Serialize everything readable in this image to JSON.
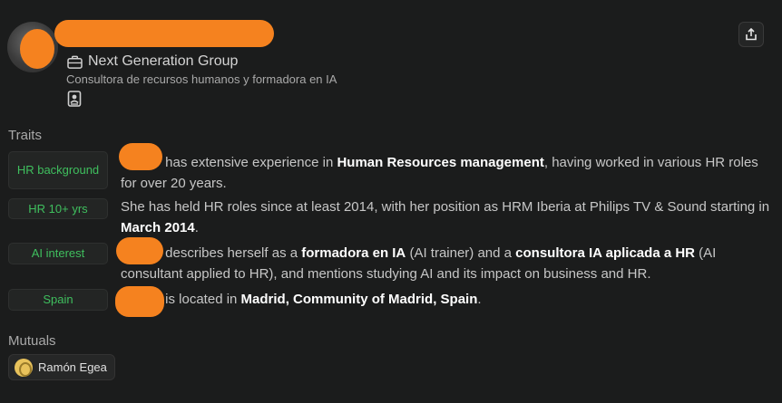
{
  "profile": {
    "company": "Next Generation Group",
    "tagline": "Consultora de recursos humanos y formadora en IA"
  },
  "sections": {
    "traits_title": "Traits",
    "mutuals_title": "Mutuals"
  },
  "traits": [
    {
      "label": "HR background",
      "parts": [
        {
          "t": " has extensive experience in ",
          "b": false
        },
        {
          "t": "Human Resources management",
          "b": true
        },
        {
          "t": ", having worked in various HR roles for over 20 years.",
          "b": false
        }
      ]
    },
    {
      "label": "HR 10+ yrs",
      "parts": [
        {
          "t": "She has held HR roles since at least 2014, with her position as HRM Iberia at Philips TV & Sound starting in ",
          "b": false
        },
        {
          "t": "March 2014",
          "b": true
        },
        {
          "t": ".",
          "b": false
        }
      ]
    },
    {
      "label": "AI interest",
      "parts": [
        {
          "t": " describes herself as a ",
          "b": false
        },
        {
          "t": "formadora en IA",
          "b": true
        },
        {
          "t": " (AI trainer) and a ",
          "b": false
        },
        {
          "t": "consultora IA aplicada a HR",
          "b": true
        },
        {
          "t": " (AI consultant applied to HR), and mentions studying AI and its impact on business and HR.",
          "b": false
        }
      ]
    },
    {
      "label": "Spain",
      "parts": [
        {
          "t": " is located in ",
          "b": false
        },
        {
          "t": "Madrid, Community of Madrid, Spain",
          "b": true
        },
        {
          "t": ".",
          "b": false
        }
      ]
    }
  ],
  "mutuals": [
    {
      "name": "Ramón Egea"
    }
  ],
  "colors": {
    "background": "#1b1c1c",
    "trait_text": "#3fbf5e",
    "redaction": "#f5821f"
  },
  "icons": [
    "briefcase-icon",
    "contact-card-icon",
    "share-icon"
  ]
}
